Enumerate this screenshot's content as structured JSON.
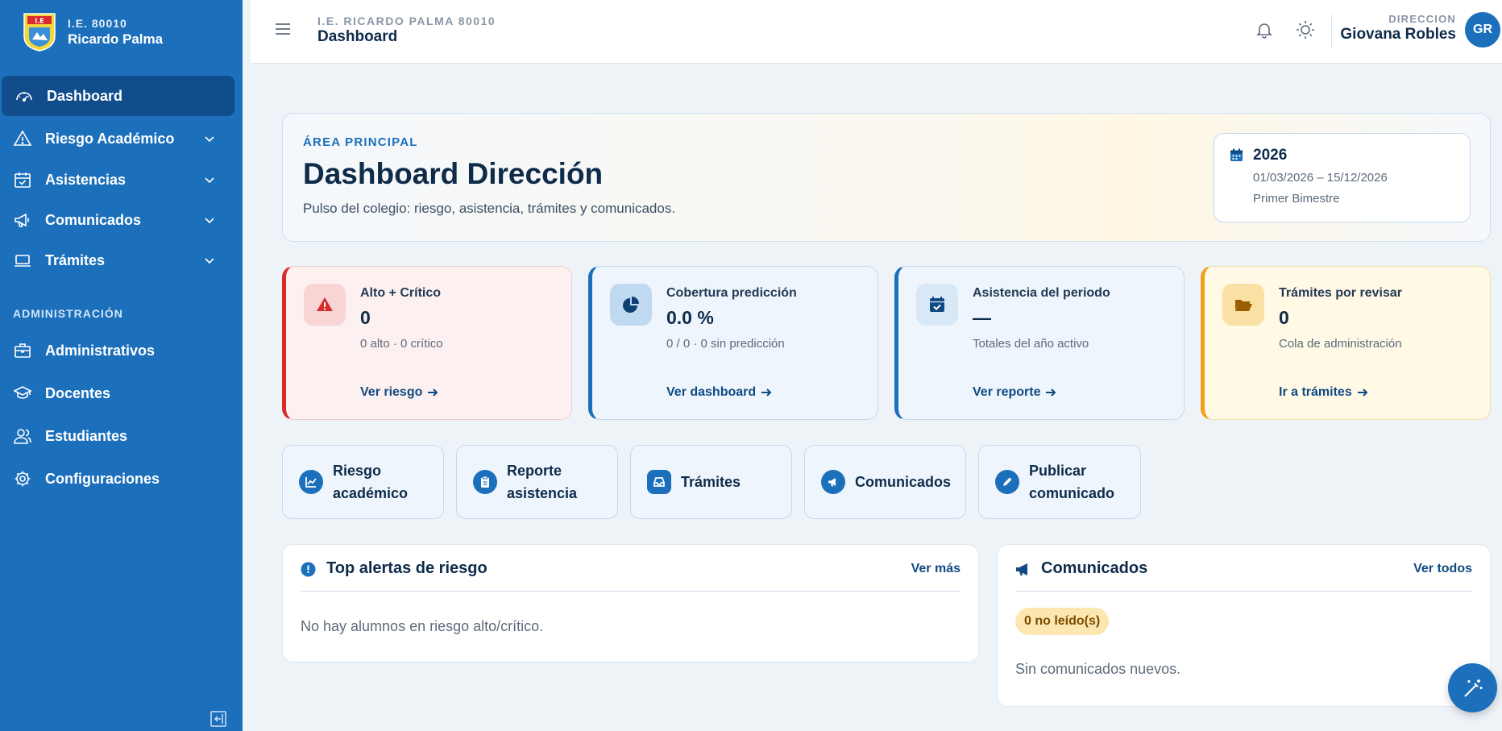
{
  "brand": {
    "line1": "I.E. 80010",
    "line2": "Ricardo Palma",
    "crest_text": "I.E"
  },
  "sidebar": {
    "items": [
      {
        "label": "Dashboard",
        "icon": "gauge-icon",
        "active": true
      },
      {
        "label": "Riesgo Académico",
        "icon": "warning-icon",
        "expandable": true
      },
      {
        "label": "Asistencias",
        "icon": "calendar-check-icon",
        "expandable": true
      },
      {
        "label": "Comunicados",
        "icon": "megaphone-icon",
        "expandable": true
      },
      {
        "label": "Trámites",
        "icon": "laptop-icon",
        "expandable": true
      }
    ],
    "section_title": "ADMINISTRACIÓN",
    "admin_items": [
      {
        "label": "Administrativos",
        "icon": "briefcase-icon"
      },
      {
        "label": "Docentes",
        "icon": "graduation-cap-icon"
      },
      {
        "label": "Estudiantes",
        "icon": "users-icon"
      },
      {
        "label": "Configuraciones",
        "icon": "gear-icon"
      }
    ]
  },
  "header": {
    "school": "I.E. RICARDO PALMA 80010",
    "title": "Dashboard",
    "role": "DIRECCION",
    "user": "Giovana Robles",
    "initials": "GR"
  },
  "hero": {
    "eyebrow": "ÁREA PRINCIPAL",
    "title": "Dashboard Dirección",
    "subtitle": "Pulso del colegio: riesgo, asistencia, trámites y comunicados.",
    "period": {
      "year": "2026",
      "range": "01/03/2026 – 15/12/2026",
      "term": "Primer Bimestre"
    }
  },
  "cards": [
    {
      "title": "Alto + Crítico",
      "value": "0",
      "sub": "0 alto · 0 crítico",
      "link": "Ver riesgo",
      "icon": "alert-triangle-icon",
      "accent": "#d62c2c"
    },
    {
      "title": "Cobertura predicción",
      "value": "0.0 %",
      "sub": "0 / 0 · 0 sin predicción",
      "link": "Ver dashboard",
      "icon": "pie-chart-icon",
      "accent": "#1c6fbb"
    },
    {
      "title": "Asistencia del periodo",
      "value": "—",
      "sub": "Totales del año activo",
      "link": "Ver reporte",
      "icon": "calendar-check-icon",
      "accent": "#1c6fbb"
    },
    {
      "title": "Trámites por revisar",
      "value": "0",
      "sub": "Cola de administración",
      "link": "Ir a trámites",
      "icon": "folder-open-icon",
      "accent": "#f0a019"
    }
  ],
  "quick_actions": [
    {
      "label": "Riesgo académico",
      "icon": "trend-chart-icon"
    },
    {
      "label": "Reporte asistencia",
      "icon": "clipboard-icon"
    },
    {
      "label": "Trámites",
      "icon": "inbox-icon"
    },
    {
      "label": "Comunicados",
      "icon": "megaphone-icon"
    },
    {
      "label": "Publicar comunicado",
      "icon": "pencil-icon"
    }
  ],
  "alerts_panel": {
    "title": "Top alertas de riesgo",
    "more": "Ver más",
    "empty": "No hay alumnos en riesgo alto/crítico."
  },
  "news_panel": {
    "title": "Comunicados",
    "more": "Ver todos",
    "badge": "0 no leído(s)",
    "empty": "Sin comunicados nuevos."
  },
  "colors": {
    "sidebar": "#1c6fbb",
    "sidebar_active": "#104d8a",
    "danger": "#d62c2c",
    "warning": "#f0a019",
    "link": "#114a83"
  }
}
